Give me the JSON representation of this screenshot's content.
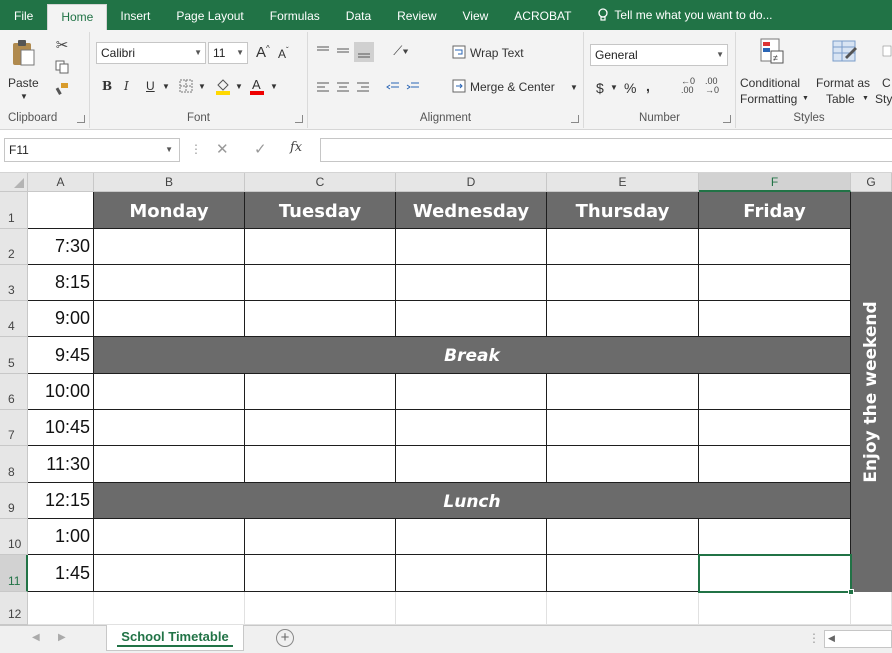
{
  "ribbon_tabs": [
    "File",
    "Home",
    "Insert",
    "Page Layout",
    "Formulas",
    "Data",
    "Review",
    "View",
    "ACROBAT"
  ],
  "tell_me": "Tell me what you want to do...",
  "clipboard": {
    "paste": "Paste",
    "label": "Clipboard"
  },
  "font": {
    "name": "Calibri",
    "size": "11",
    "label": "Font",
    "bold": "B",
    "italic": "I",
    "underline": "U"
  },
  "alignment": {
    "wrap": "Wrap Text",
    "merge": "Merge & Center",
    "label": "Alignment"
  },
  "number": {
    "format": "General",
    "currency": "$",
    "percent": "%",
    "comma": ",",
    "label": "Number"
  },
  "styles": {
    "cond1": "Conditional",
    "cond2": "Formatting",
    "fmt1": "Format as",
    "fmt2": "Table",
    "cell_partial1": "C",
    "cell_partial2": "Sty",
    "label": "Styles"
  },
  "formula_bar": {
    "name_box": "F11",
    "fx": "fx",
    "formula": ""
  },
  "columns": [
    "A",
    "B",
    "C",
    "D",
    "E",
    "F",
    "G"
  ],
  "rows": [
    "1",
    "2",
    "3",
    "4",
    "5",
    "6",
    "7",
    "8",
    "9",
    "10",
    "11",
    "12"
  ],
  "timetable": {
    "days": [
      "Monday",
      "Tuesday",
      "Wednesday",
      "Thursday",
      "Friday"
    ],
    "times": [
      "7:30",
      "8:15",
      "9:00",
      "9:45",
      "10:00",
      "10:45",
      "11:30",
      "12:15",
      "1:00",
      "1:45"
    ],
    "break_label": "Break",
    "lunch_label": "Lunch",
    "weekend_label": "Enjoy the weekend"
  },
  "sheet_tab": "School Timetable",
  "colors": {
    "accent": "#217346",
    "header_fill": "#6b6b6b"
  }
}
